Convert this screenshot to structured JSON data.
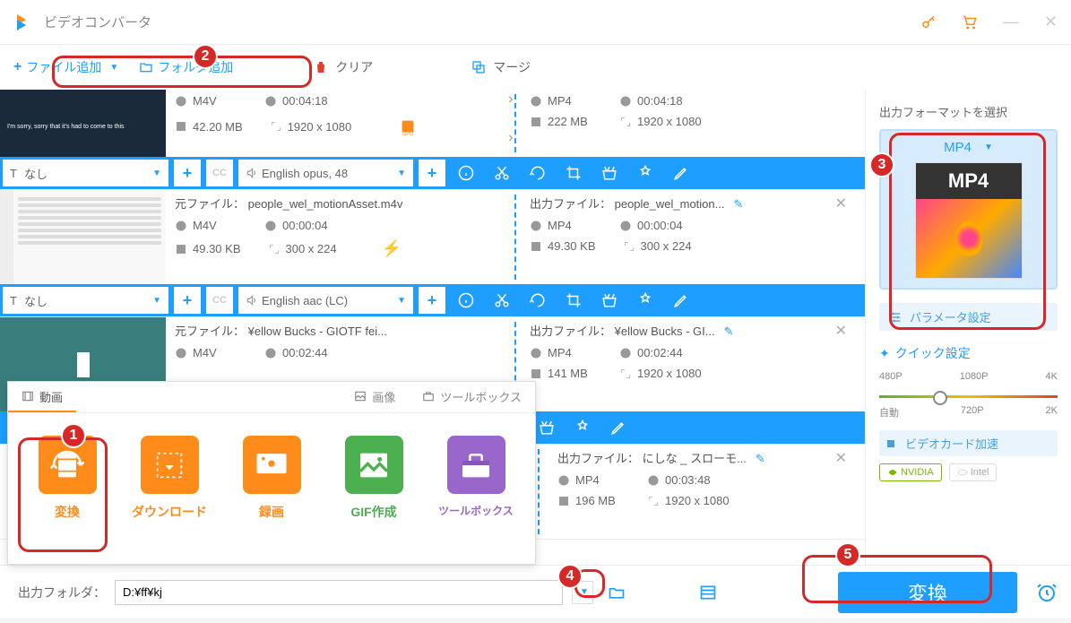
{
  "app_title": "ビデオコンバータ",
  "toolbar": {
    "add_file": "ファイル追加",
    "add_folder": "フォルダ追加",
    "clear": "クリア",
    "merge": "マージ"
  },
  "files": [
    {
      "src_format": "M4V",
      "src_duration": "00:04:18",
      "src_size": "42.20 MB",
      "src_res": "1920 x 1080",
      "out_format": "MP4",
      "out_duration": "00:04:18",
      "out_size": "222 MB",
      "out_res": "1920 x 1080",
      "subtitle": "なし",
      "audio": "English opus, 48",
      "thumb_caption": "I'm sorry, sorry that it's had to come to this",
      "gpu": true
    },
    {
      "src_name": "元ファイル： people_wel_motionAsset.m4v",
      "out_name": "出力ファイル： people_wel_motion...",
      "src_format": "M4V",
      "src_duration": "00:00:04",
      "src_size": "49.30 KB",
      "src_res": "300 x 224",
      "out_format": "MP4",
      "out_duration": "00:00:04",
      "out_size": "49.30 KB",
      "out_res": "300 x 224",
      "subtitle": "なし",
      "audio": "English aac (LC)",
      "lightning": true
    },
    {
      "src_name": "元ファイル： ¥ellow Bucks - GIOTF fei...",
      "out_name": "出力ファイル： ¥ellow Bucks - GI...",
      "src_format": "M4V",
      "src_duration": "00:02:44",
      "out_format": "MP4",
      "out_duration": "00:02:44",
      "out_size": "141 MB",
      "out_res": "1920 x 1080"
    },
    {
      "out_name": "出力ファイル： にしな _ スローモ...",
      "out_format": "MP4",
      "out_duration": "00:03:48",
      "out_size": "196 MB",
      "out_res": "1920 x 1080"
    }
  ],
  "popup": {
    "tab_video": "動画",
    "tab_image": "画像",
    "tab_toolbox": "ツールボックス",
    "tools": [
      {
        "label": "変換",
        "color": "#ff8c1a"
      },
      {
        "label": "ダウンロード",
        "color": "#ff8c1a"
      },
      {
        "label": "録画",
        "color": "#ff8c1a"
      },
      {
        "label": "GIF作成",
        "color": "#4caf50"
      },
      {
        "label": "ツールボックス",
        "color": "#9966cc"
      }
    ]
  },
  "output": {
    "panel_title": "出力フォーマットを選択",
    "format": "MP4",
    "param_settings": "パラメータ設定",
    "quick_settings": "クイック設定",
    "quality_labels_top": [
      "480P",
      "1080P",
      "4K"
    ],
    "quality_labels_bottom": [
      "自動",
      "720P",
      "2K"
    ],
    "gpu_accel": "ビデオカード加速",
    "gpu_nvidia": "NVIDIA",
    "gpu_intel": "Intel"
  },
  "bottom": {
    "out_folder_label": "出力フォルダ：",
    "out_folder_value": "D:¥ff¥kj",
    "convert": "変換"
  },
  "annotations": {
    "n1": "1",
    "n2": "2",
    "n3": "3",
    "n4": "4",
    "n5": "5"
  }
}
